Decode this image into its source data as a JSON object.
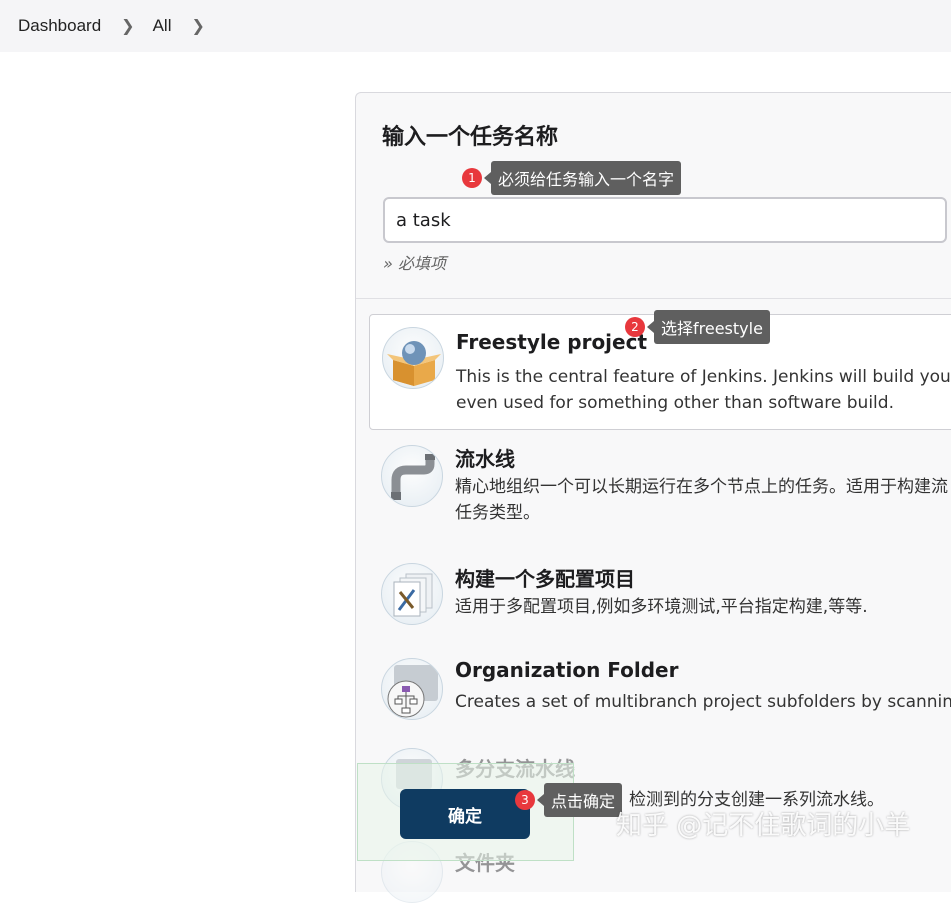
{
  "breadcrumb": {
    "items": [
      "Dashboard",
      "All"
    ]
  },
  "form": {
    "section_title": "输入一个任务名称",
    "name_value": "a task",
    "required_hint": "» 必填项"
  },
  "items": [
    {
      "name": "Freestyle project",
      "desc": [
        "This is the central feature of Jenkins. Jenkins will build your pro",
        "even used for something other than software build."
      ],
      "icon": "freestyle-box-icon"
    },
    {
      "name": "流水线",
      "desc": [
        "精心地组织一个可以长期运行在多个节点上的任务。适用于构建流",
        "任务类型。"
      ],
      "icon": "pipeline-icon"
    },
    {
      "name": "构建一个多配置项目",
      "desc": [
        "适用于多配置项目,例如多环境测试,平台指定构建,等等."
      ],
      "icon": "multi-config-icon"
    },
    {
      "name": "Organization Folder",
      "desc": [
        "Creates a set of multibranch project subfolders by scanning fo"
      ],
      "icon": "organization-folder-icon"
    },
    {
      "name": "多分支流水线",
      "desc": [
        "检测到的分支创建一系列流水线。"
      ],
      "icon": "multibranch-pipeline-icon"
    },
    {
      "name": "文件夹",
      "desc": [],
      "icon": "folder-icon"
    }
  ],
  "callouts": [
    {
      "num": "1",
      "text": "必须给任务输入一个名字"
    },
    {
      "num": "2",
      "text": "选择freestyle"
    },
    {
      "num": "3",
      "text": "点击确定"
    }
  ],
  "ok_button": "确定",
  "watermark": "知乎 @记不住歌词的小羊"
}
